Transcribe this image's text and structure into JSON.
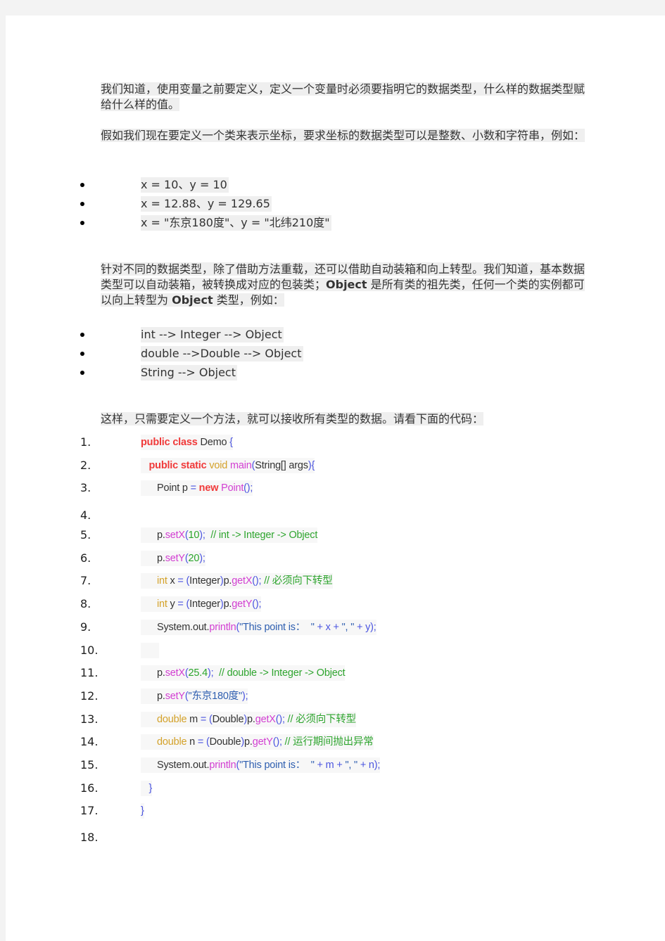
{
  "paragraphs": {
    "p1": "我们知道，使用变量之前要定义，定义一个变量时必须要指明它的数据类型，什么样的数据类型赋给什么样的值。",
    "p2": "假如我们现在要定义一个类来表示坐标，要求坐标的数据类型可以是整数、小数和字符串，例如：",
    "p3_part1": "针对不同的数据类型，除了借助方法重载，还可以借助自动装箱和向上转型。我们知道，基本数据类型可以自动装箱，被转换成对应的包装类；",
    "p3_object1": "Object",
    "p3_part2": " 是所有类的祖先类，任何一个类的实例都可以向上转型为 ",
    "p3_object2": "Object",
    "p3_part3": " 类型，例如：",
    "p4": "这样，只需要定义一个方法，就可以接收所有类型的数据。请看下面的代码："
  },
  "examples": [
    "x = 10、y = 10",
    "x = 12.88、y = 129.65",
    "x = \"东京180度\"、y = \"北纬210度\""
  ],
  "conversions": [
    "int --> Integer --> Object",
    "double -->Double --> Object",
    "String --> Object"
  ],
  "code": {
    "line_numbers": [
      "1.",
      "2.",
      "3.",
      "4.",
      "5.",
      "6.",
      "7.",
      "8.",
      "9.",
      "10.",
      "11.",
      "12.",
      "13.",
      "14.",
      "15.",
      "16.",
      "17.",
      "18."
    ],
    "l1": {
      "kw": "public class",
      "name": " Demo ",
      "brace": "{"
    },
    "l2": {
      "indent": "   ",
      "kw": "public static",
      "ty": " void",
      "fn": " main",
      "open": "(",
      "args": "String[] args",
      "close": "){"
    },
    "l3": {
      "indent": "      ",
      "a": "Point p ",
      "eq": "= ",
      "kw": "new",
      "fn": " Point",
      "paren": "();"
    },
    "l5": {
      "indent": "      ",
      "a": "p.",
      "fn": "setX",
      "open": "(",
      "num": "10",
      "close": ");",
      "comment": "  // int -> Integer -> Object"
    },
    "l6": {
      "indent": "      ",
      "a": "p.",
      "fn": "setY",
      "open": "(",
      "num": "20",
      "close": ");"
    },
    "l7": {
      "indent": "      ",
      "ty": "int",
      "a": " x ",
      "eq": "= ",
      "open": "(",
      "cast": "Integer",
      "close": ")",
      "b": "p.",
      "fn": "getX",
      "paren": "();",
      "comment": " // 必须向下转型"
    },
    "l8": {
      "indent": "      ",
      "ty": "int",
      "a": " y ",
      "eq": "= ",
      "open": "(",
      "cast": "Integer",
      "close": ")",
      "b": "p.",
      "fn": "getY",
      "paren": "();"
    },
    "l9": {
      "indent": "      ",
      "a": "System.out.",
      "fn": "println",
      "open": "(",
      "str": "\"This point is：  \"",
      "rest": " + x + ",
      "str2": "\", \"",
      "rest2": " + y",
      "close": ");"
    },
    "l11": {
      "indent": "      ",
      "a": "p.",
      "fn": "setX",
      "open": "(",
      "num": "25.4",
      "close": ");",
      "comment": "  // double -> Integer -> Object"
    },
    "l12": {
      "indent": "      ",
      "a": "p.",
      "fn": "setY",
      "open": "(",
      "str": "\"东京180度\"",
      "close": ");"
    },
    "l13": {
      "indent": "      ",
      "ty": "double",
      "a": " m ",
      "eq": "= ",
      "open": "(",
      "cast": "Double",
      "close": ")",
      "b": "p.",
      "fn": "getX",
      "paren": "();",
      "comment": " // 必须向下转型"
    },
    "l14": {
      "indent": "      ",
      "ty": "double",
      "a": " n ",
      "eq": "= ",
      "open": "(",
      "cast": "Double",
      "close": ")",
      "b": "p.",
      "fn": "getY",
      "paren": "();",
      "comment": " // 运行期间抛出异常"
    },
    "l15": {
      "indent": "      ",
      "a": "System.out.",
      "fn": "println",
      "open": "(",
      "str": "\"This point is：  \"",
      "rest": " + m + ",
      "str2": "\", \"",
      "rest2": " + n",
      "close": ");"
    },
    "l16": {
      "indent": "   ",
      "brace": "}"
    },
    "l17": {
      "brace": "}"
    }
  }
}
